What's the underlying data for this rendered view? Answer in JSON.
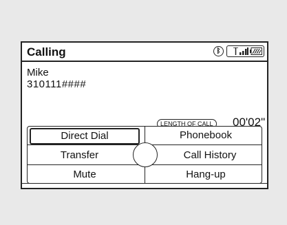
{
  "header": {
    "title": "Calling",
    "bluetooth_icon": "bluetooth-icon",
    "signal_icon": "signal-strength-icon",
    "battery_icon": "battery-icon"
  },
  "call": {
    "name": "Mike",
    "number": "310111####",
    "length_label": "LENGTH OF CALL",
    "duration": "00'02\""
  },
  "menu": {
    "items": [
      {
        "label": "Direct Dial",
        "selected": true
      },
      {
        "label": "Phonebook",
        "selected": false
      },
      {
        "label": "Transfer",
        "selected": false
      },
      {
        "label": "Call History",
        "selected": false
      },
      {
        "label": "Mute",
        "selected": false
      },
      {
        "label": "Hang-up",
        "selected": false
      }
    ],
    "knob_icon": "selector-knob-icon"
  }
}
